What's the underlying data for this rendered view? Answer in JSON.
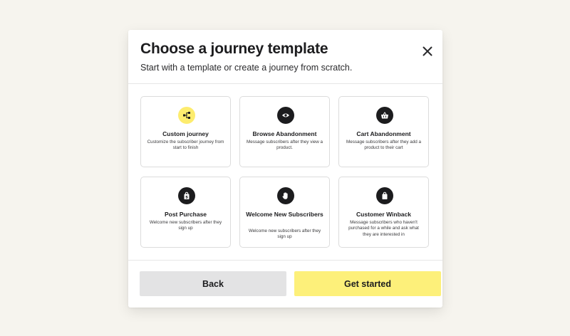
{
  "modal": {
    "title": "Choose a journey template",
    "subtitle": "Start with a template or create a journey from scratch."
  },
  "templates": [
    {
      "title": "Custom journey",
      "description": "Customize the subscriber journey from start to finish",
      "icon": "flow-icon",
      "selected": true
    },
    {
      "title": "Browse Abandonment",
      "description": "Message subscribers after they view a product.",
      "icon": "eye-icon"
    },
    {
      "title": "Cart Abandonment",
      "description": "Message subscribers after they add a product to their cart",
      "icon": "basket-icon"
    },
    {
      "title": "Post Purchase",
      "description": "Welcome new subscribers after they sign up",
      "icon": "shopping-bag-dollar-icon"
    },
    {
      "title": "Welcome New Subscribers",
      "description": "Welcome new subscribers after they sign up",
      "icon": "wave-hand-icon"
    },
    {
      "title": "Customer Winback",
      "description": "Message subscribers who haven't purchased for a while and ask what they are interested in",
      "icon": "shopping-bag-icon"
    }
  ],
  "buttons": {
    "back_label": "Back",
    "start_label": "Get started"
  },
  "colors": {
    "accent": "#fdf07a",
    "secondary_button": "#e3e3e4",
    "icon_dark": "#1c1c1e"
  }
}
